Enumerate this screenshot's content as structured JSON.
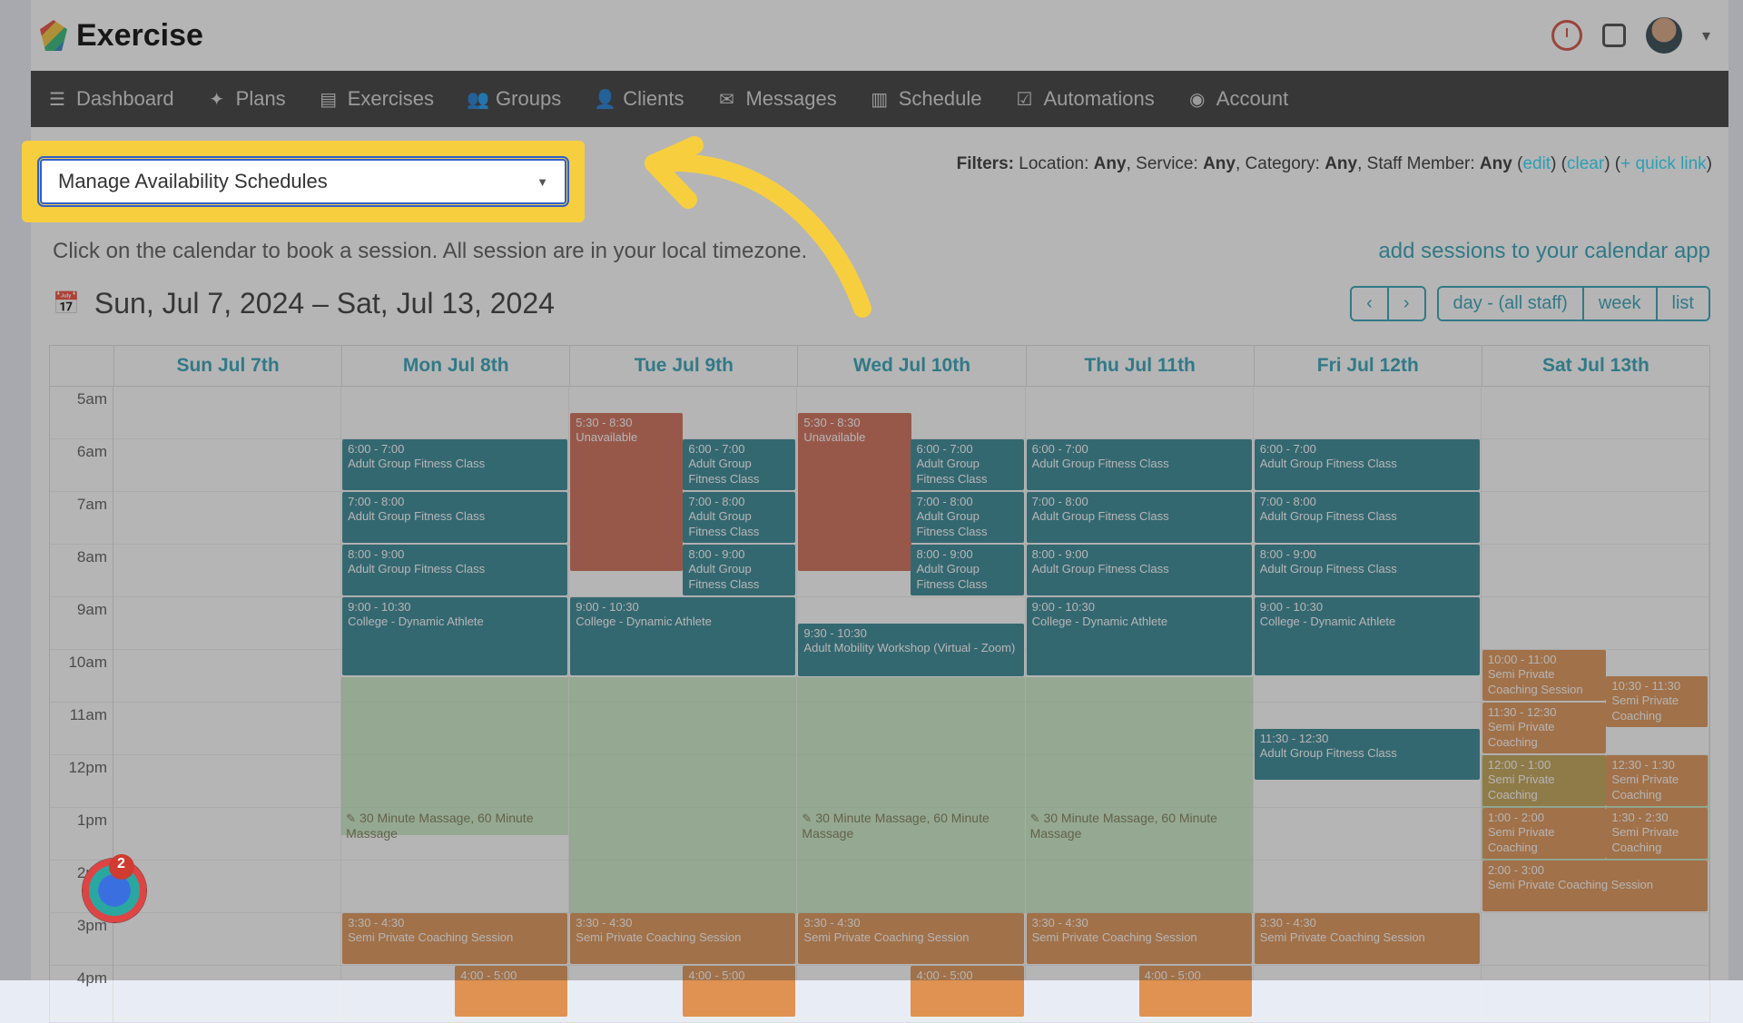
{
  "brand": "Exercise",
  "nav": {
    "dashboard": "Dashboard",
    "plans": "Plans",
    "exercises": "Exercises",
    "groups": "Groups",
    "clients": "Clients",
    "messages": "Messages",
    "schedule": "Schedule",
    "automations": "Automations",
    "account": "Account"
  },
  "toolbar": {
    "dropdown_label": "Manage Availability Schedules"
  },
  "filters": {
    "label": "Filters:",
    "location_label": "Location:",
    "location_value": "Any",
    "service_label": "Service:",
    "service_value": "Any",
    "category_label": "Category:",
    "category_value": "Any",
    "staff_label": "Staff Member:",
    "staff_value": "Any",
    "edit": "edit",
    "clear": "clear",
    "quicklink": "+ quick link"
  },
  "instructions": "Click on the calendar to book a session. All session are in your local timezone.",
  "add_sessions_link": "add sessions to your calendar app",
  "date_range": "Sun, Jul 7, 2024 – Sat, Jul 13, 2024",
  "nav_buttons": {
    "prev": "‹",
    "next": "›"
  },
  "view_buttons": {
    "day": "day - (all staff)",
    "week": "week",
    "list": "list"
  },
  "days": [
    "Sun Jul 7th",
    "Mon Jul 8th",
    "Tue Jul 9th",
    "Wed Jul 10th",
    "Thu Jul 11th",
    "Fri Jul 12th",
    "Sat Jul 13th"
  ],
  "hours": [
    "5am",
    "6am",
    "7am",
    "8am",
    "9am",
    "10am",
    "11am",
    "12pm",
    "1pm",
    "2pm",
    "3pm",
    "4pm"
  ],
  "events_common": {
    "agfc": "Adult Group Fitness Class",
    "unavail": "Unavailable",
    "college": "College - Dynamic Athlete",
    "mobility": "Adult Mobility Workshop (Virtual - Zoom)",
    "massage": "30 Minute Massage, 60 Minute Massage",
    "spcs": "Semi Private Coaching Session",
    "spc": "Semi Private Coaching"
  },
  "times": {
    "t530_830": "5:30 - 8:30",
    "t6_7": "6:00 - 7:00",
    "t7_8": "7:00 - 8:00",
    "t8_9": "8:00 - 9:00",
    "t9_1030": "9:00 - 10:30",
    "t930_1030": "9:30 - 10:30",
    "t10_11": "10:00 - 11:00",
    "t1030_1130": "10:30 - 11:30",
    "t1130_1230": "11:30 - 12:30",
    "t12_1": "12:00 - 1:00",
    "t1230_130": "12:30 - 1:30",
    "t1_2": "1:00 - 2:00",
    "t130_230": "1:30 - 2:30",
    "t2_3": "2:00 - 3:00",
    "t330_430": "3:30 - 4:30",
    "t4_5": "4:00 - 5:00"
  },
  "badge_count": "2"
}
